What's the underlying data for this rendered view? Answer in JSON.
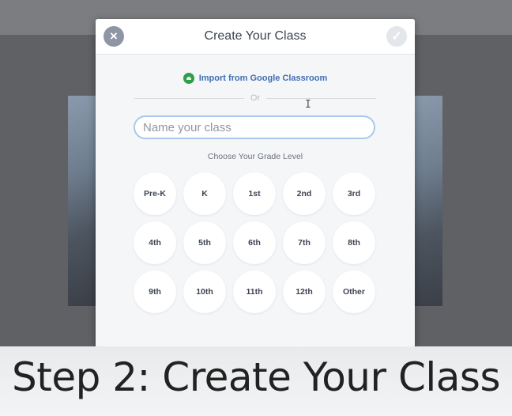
{
  "dialog": {
    "title": "Create Your Class",
    "close_icon": "×",
    "confirm_icon": "✓",
    "import_label": "Import from Google Classroom",
    "or_text": "Or",
    "name_placeholder": "Name your class",
    "grade_heading": "Choose Your Grade Level",
    "grades": [
      "Pre-K",
      "K",
      "1st",
      "2nd",
      "3rd",
      "4th",
      "5th",
      "6th",
      "7th",
      "8th",
      "9th",
      "10th",
      "11th",
      "12th",
      "Other"
    ]
  },
  "caption": "Step 2: Create Your Class",
  "icons": {
    "close": "close-icon",
    "confirm": "checkmark-icon",
    "import": "google-classroom-icon"
  },
  "colors": {
    "accent_link": "#3f6fb3",
    "input_border": "#a9c7ea",
    "google_classroom_green": "#2f9f4d"
  }
}
